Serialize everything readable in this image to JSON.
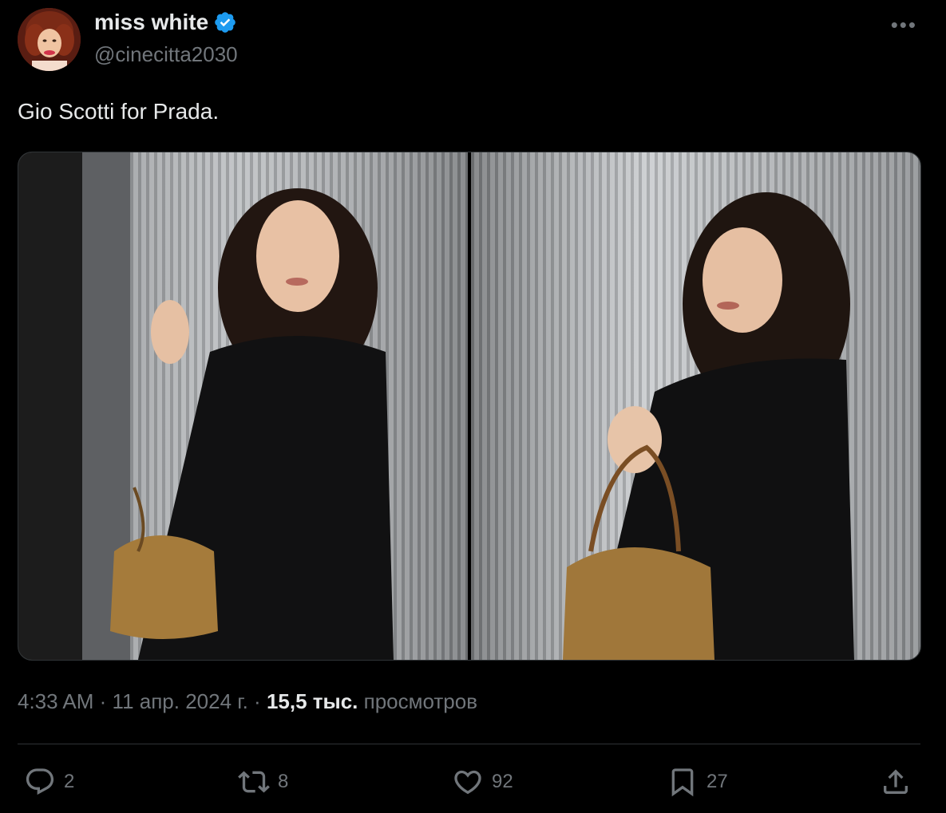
{
  "author": {
    "display_name": "miss white",
    "handle": "@cinecitta2030",
    "verified": true
  },
  "tweet": {
    "text": "Gio Scotti for Prada."
  },
  "meta": {
    "time": "4:33 AM",
    "date": "11 апр. 2024 г.",
    "separator": "·",
    "views_count": "15,5 тыс.",
    "views_label": "просмотров"
  },
  "actions": {
    "replies": "2",
    "reposts": "8",
    "likes": "92",
    "bookmarks": "27"
  },
  "colors": {
    "background": "#000000",
    "text_primary": "#e7e9ea",
    "text_secondary": "#71767b",
    "verified_blue": "#1d9bf0",
    "divider": "#2f3336"
  },
  "icons": [
    "verified-icon",
    "more-icon",
    "reply-icon",
    "repost-icon",
    "like-icon",
    "bookmark-icon",
    "share-icon"
  ]
}
